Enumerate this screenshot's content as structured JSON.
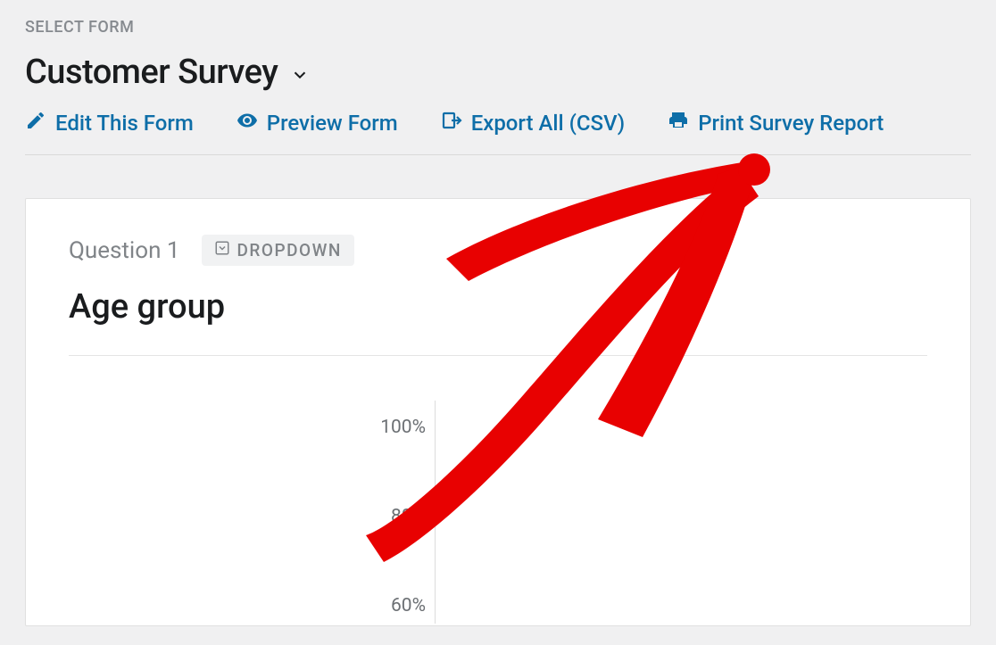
{
  "header": {
    "select_form_label": "SELECT FORM",
    "form_title": "Customer Survey"
  },
  "actions": {
    "edit": "Edit This Form",
    "preview": "Preview Form",
    "export": "Export All (CSV)",
    "print": "Print Survey Report"
  },
  "question": {
    "label": "Question 1",
    "type_badge": "DROPDOWN",
    "title": "Age group"
  },
  "chart_data": {
    "type": "bar",
    "ylabel": "",
    "ylim": [
      0,
      100
    ],
    "y_ticks": [
      "100%",
      "80%",
      "60%"
    ]
  },
  "annotation": {
    "arrow_color": "#e80101",
    "points_to": "print-report-link"
  }
}
